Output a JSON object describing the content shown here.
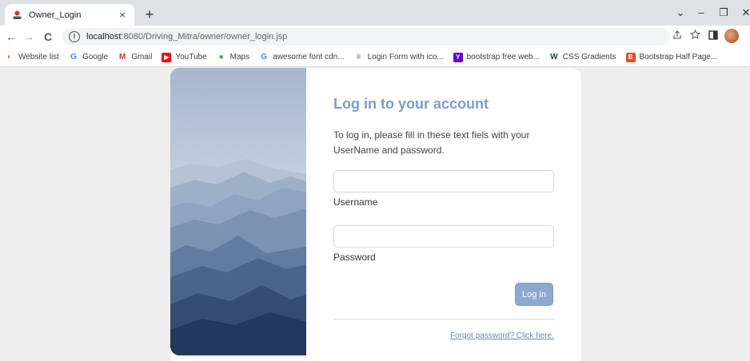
{
  "browser": {
    "tab": {
      "title": "Owner_Login",
      "close_glyph": "×"
    },
    "new_tab_glyph": "+",
    "window_controls": {
      "dropdown": "⌄",
      "minimize": "–",
      "restore": "❐",
      "close": "✕"
    },
    "nav": {
      "back": "←",
      "forward": "→",
      "reload": "C"
    },
    "address": {
      "host": "localhost",
      "path": ":8080/Driving_Mitra/owner/owner_login.jsp"
    },
    "bookmarks": [
      {
        "label": "Website list",
        "icon": "website-icon",
        "color": "#e8711a"
      },
      {
        "label": "Google",
        "icon": "google-icon",
        "color": "#4285f4"
      },
      {
        "label": "Gmail",
        "icon": "gmail-icon",
        "color": "#d93025"
      },
      {
        "label": "YouTube",
        "icon": "youtube-icon",
        "color": "#ff0000"
      },
      {
        "label": "Maps",
        "icon": "maps-icon",
        "color": "#34a853"
      },
      {
        "label": "awesome font cdn...",
        "icon": "google-icon",
        "color": "#4285f4"
      },
      {
        "label": "Login Form with ico...",
        "icon": "codepen-icon",
        "color": "#4f6ad1"
      },
      {
        "label": "bootstrap free web...",
        "icon": "yahoo-icon",
        "color": "#6001d2"
      },
      {
        "label": "CSS Gradients",
        "icon": "webflow-icon",
        "color": "#1f4d30"
      },
      {
        "label": "Bootstrap Half Page...",
        "icon": "bootstrap-icon",
        "color": "#e34c26"
      }
    ]
  },
  "login": {
    "heading": "Log in to your account",
    "intro": "To log in, please fill in these text fiels with your UserName and password.",
    "username_label": "Username",
    "username_value": "",
    "password_label": "Password",
    "password_value": "",
    "submit_label": "Log in",
    "forgot_link": "Forgot password? Click here."
  },
  "colors": {
    "accent": "#7f9cc4",
    "button": "#8ea9cf",
    "link": "#6c8ab3"
  }
}
